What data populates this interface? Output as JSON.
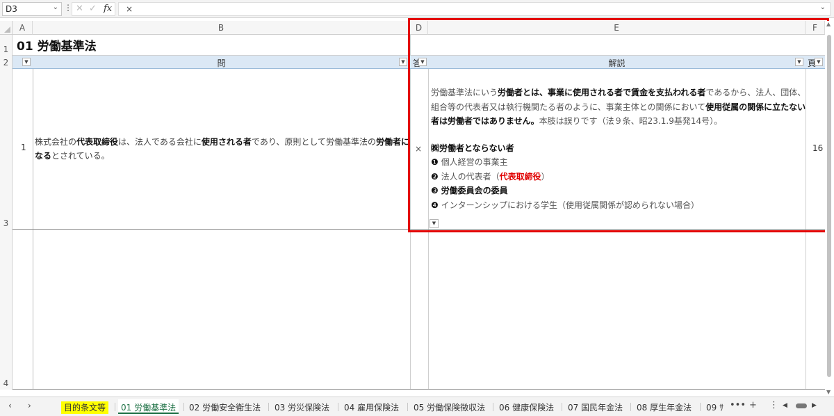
{
  "formula_bar": {
    "cell_ref": "D3",
    "cancel_glyph": "✕",
    "ok_glyph": "✓",
    "fx_label": "fx",
    "content": "×"
  },
  "columns": [
    "A",
    "B",
    "D",
    "E",
    "F"
  ],
  "rows": [
    "1",
    "2",
    "3",
    "4"
  ],
  "title": "01 労働基準法",
  "table_header": {
    "question": "問",
    "answer_short": "答",
    "explanation": "解説",
    "ref_short": "頁"
  },
  "record": {
    "number": "1",
    "question_parts": [
      {
        "t": "株式会社の",
        "b": false
      },
      {
        "t": "代表取締役",
        "b": true
      },
      {
        "t": "は、法人である会社に",
        "b": false
      },
      {
        "t": "使用される者",
        "b": true
      },
      {
        "t": "であり、原則として労働基準法の",
        "b": false
      },
      {
        "t": "労働者になる",
        "b": true
      },
      {
        "t": "とされている。",
        "b": false
      }
    ],
    "answer": "×",
    "explanation": {
      "p1": "労働基準法にいう",
      "p1_bold": "労働者とは、事業に使用される者で賃金を支払われる者",
      "p2": "であるから、法人、団体、組合等の代表者又は執行機関たる者のように、事業主体との関係において",
      "p2_bold": "使用従属の関係に立たない者は労働者ではありません。",
      "p3": "本肢は誤りです（法９条、昭23.1.9基発14号）。",
      "heading": "㈱労働者とならない者",
      "items": [
        {
          "num": "❶",
          "pre": "個人経営の事業主",
          "red": "",
          "post": "",
          "bold": false
        },
        {
          "num": "❷",
          "pre": "法人の代表者（",
          "red": "代表取締役",
          "post": "）",
          "bold": false
        },
        {
          "num": "❸",
          "pre": "労働委員会の委員",
          "red": "",
          "post": "",
          "bold": true
        },
        {
          "num": "❹",
          "pre": "インターンシップにおける学生（使用従属関係が認められない場合）",
          "red": "",
          "post": "",
          "bold": false
        }
      ]
    },
    "page": "16"
  },
  "sheet_tabs": [
    "目的条文等",
    "01 労働基準法",
    "02 労働安全衛生法",
    "03 労災保険法",
    "04 雇用保険法",
    "05 労働保険徴収法",
    "06 健康保険法",
    "07 国民年金法",
    "08 厚生年金法",
    "09 ｻ"
  ],
  "active_tab": "01 労働基準法",
  "highlight_color": "#e30000",
  "header_fill": "#dbe8f5"
}
